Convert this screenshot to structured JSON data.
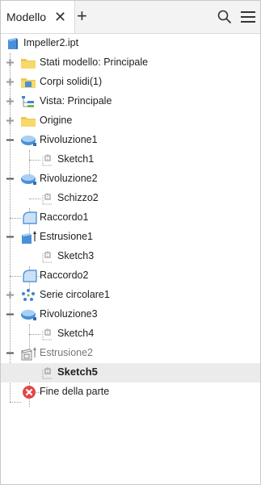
{
  "header": {
    "tab_label": "Modello",
    "add_tab": "+"
  },
  "tree": {
    "items": [
      {
        "label": "Impeller2.ipt",
        "icon": "part-file-icon"
      },
      {
        "label": "Stati modello: Principale",
        "icon": "folder-icon",
        "expander": "plus"
      },
      {
        "label": "Corpi solidi(1)",
        "icon": "solid-bodies-folder-icon",
        "expander": "plus"
      },
      {
        "label": "Vista: Principale",
        "icon": "view-rep-icon",
        "expander": "plus"
      },
      {
        "label": "Origine",
        "icon": "folder-icon",
        "expander": "plus"
      },
      {
        "label": "Rivoluzione1",
        "icon": "revolve-icon",
        "expander": "minus"
      },
      {
        "label": "Sketch1",
        "icon": "sketch-icon"
      },
      {
        "label": "Rivoluzione2",
        "icon": "revolve-icon",
        "expander": "minus"
      },
      {
        "label": "Schizzo2",
        "icon": "sketch-icon"
      },
      {
        "label": "Raccordo1",
        "icon": "fillet-icon"
      },
      {
        "label": "Estrusione1",
        "icon": "extrude-icon",
        "expander": "minus"
      },
      {
        "label": "Sketch3",
        "icon": "sketch-icon"
      },
      {
        "label": "Raccordo2",
        "icon": "fillet-icon"
      },
      {
        "label": "Serie circolare1",
        "icon": "circular-pattern-icon",
        "expander": "plus"
      },
      {
        "label": "Rivoluzione3",
        "icon": "revolve-icon",
        "expander": "minus"
      },
      {
        "label": "Sketch4",
        "icon": "sketch-icon"
      },
      {
        "label": "Estrusione2",
        "icon": "extrude-suppressed-icon",
        "expander": "minus",
        "state": "suppressed"
      },
      {
        "label": "Sketch5",
        "icon": "sketch-icon",
        "state": "selected"
      },
      {
        "label": "Fine della parte",
        "icon": "end-of-part-icon"
      }
    ]
  }
}
